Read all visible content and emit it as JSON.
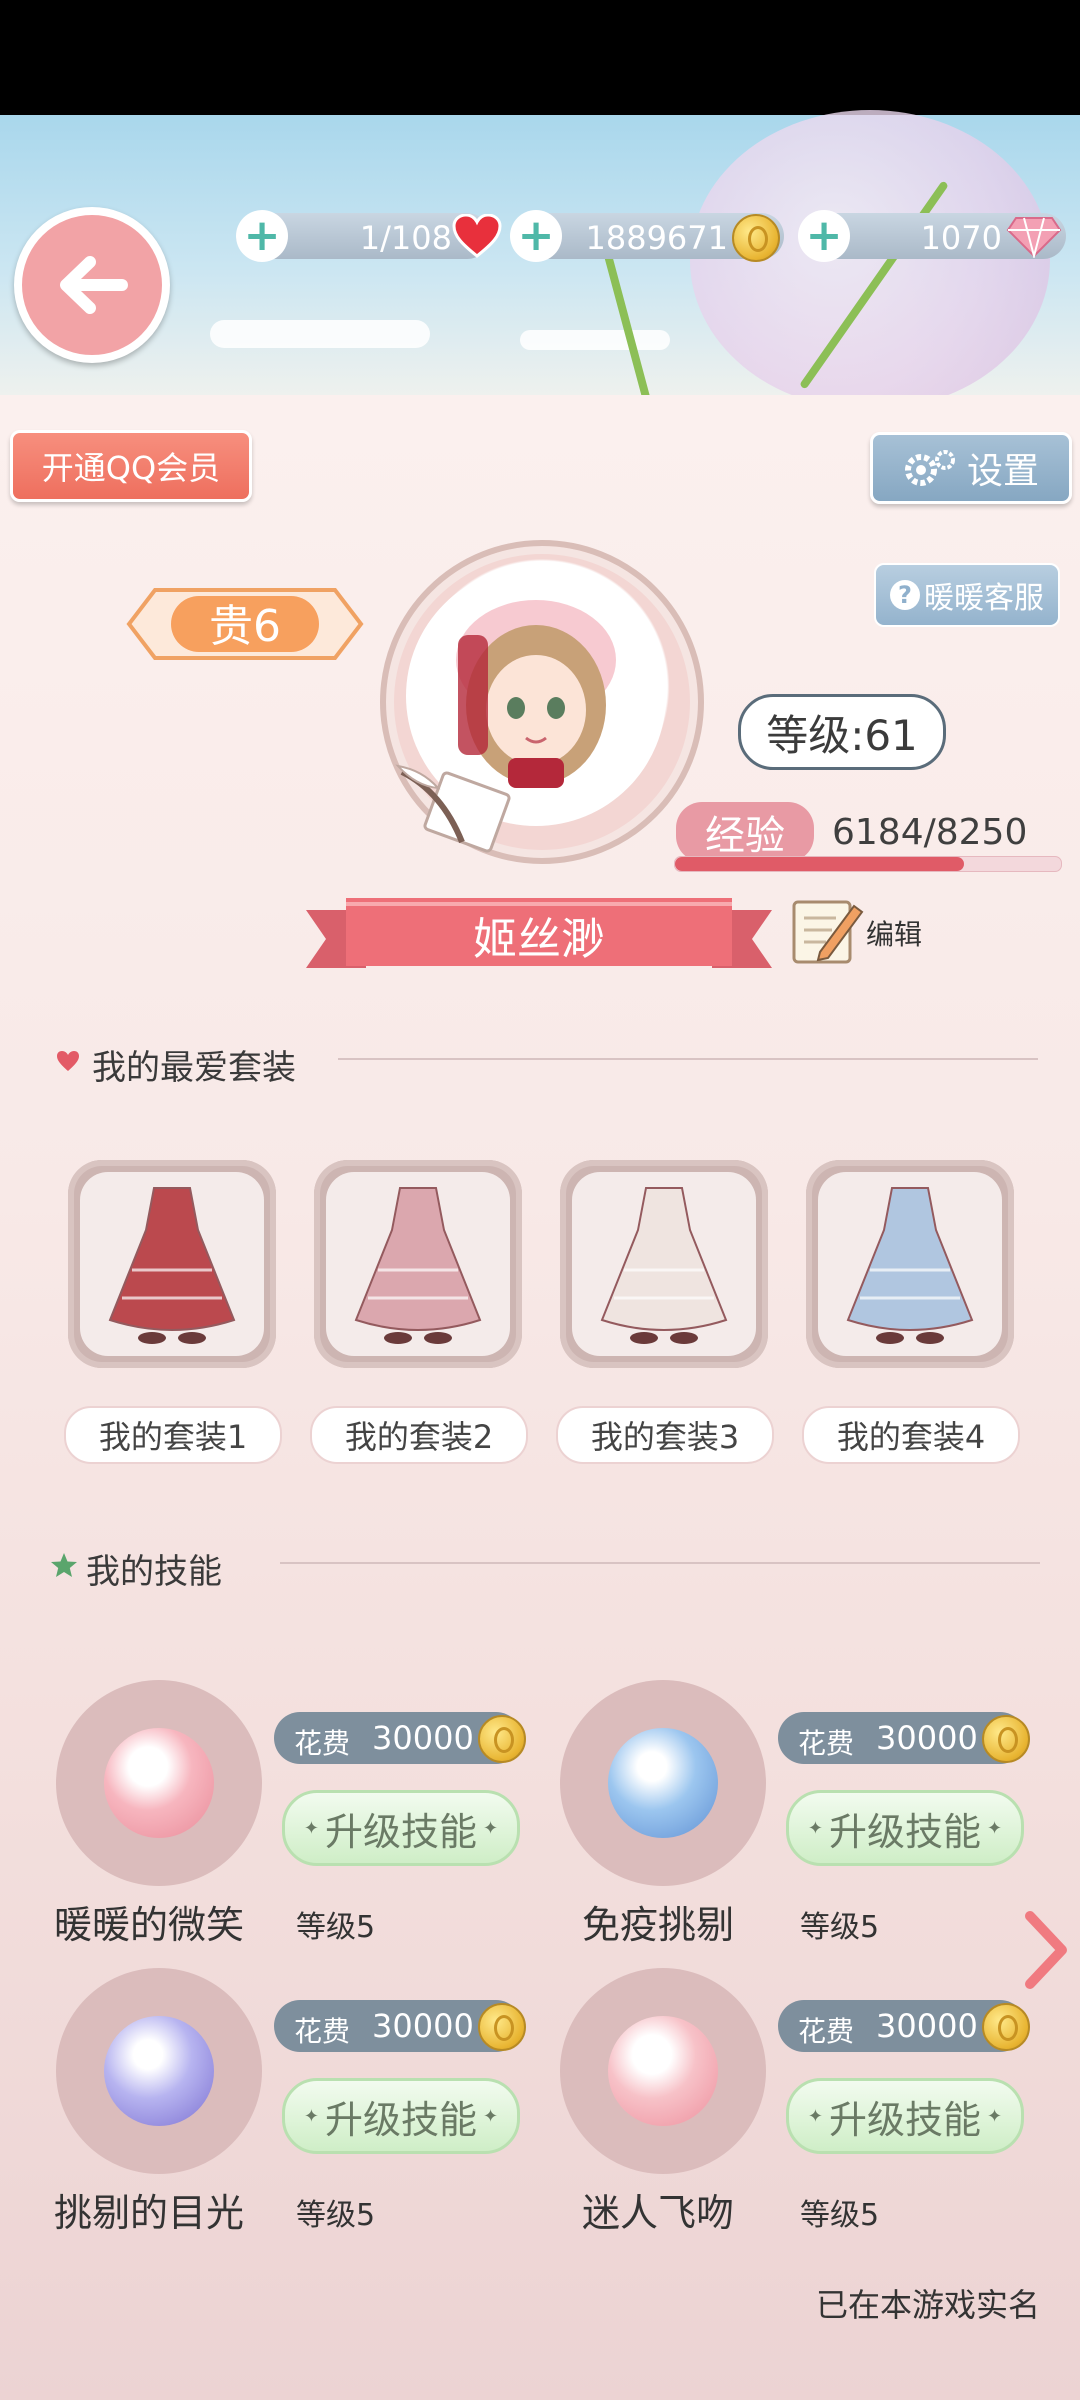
{
  "topbar": {
    "stamina": "1/108",
    "gold": "1889671",
    "diamonds": "1070"
  },
  "buttons": {
    "qq_member": "开通QQ会员",
    "settings": "设置",
    "customer_service": "暖暖客服",
    "edit": "编辑"
  },
  "profile": {
    "vip": "贵6",
    "level": "等级:61",
    "exp_label": "经验",
    "exp_value": "6184/8250",
    "exp_fraction": 0.7496,
    "name": "姬丝渺"
  },
  "outfits": {
    "title": "我的最爱套装",
    "items": [
      {
        "label": "我的套装1",
        "color": "#b5383e"
      },
      {
        "label": "我的套装2",
        "color": "#d9a0a8"
      },
      {
        "label": "我的套装3",
        "color": "#efe4e0"
      },
      {
        "label": "我的套装4",
        "color": "#a9c2e0"
      }
    ]
  },
  "skills": {
    "title": "我的技能",
    "items": [
      {
        "name": "暖暖的微笑",
        "level": "等级5",
        "cost_label": "花费",
        "cost": "30000",
        "upgrade": "升级技能",
        "icon": "sakura-icon"
      },
      {
        "name": "免疫挑剔",
        "level": "等级5",
        "cost_label": "花费",
        "cost": "30000",
        "upgrade": "升级技能",
        "icon": "winged-mask-icon"
      },
      {
        "name": "挑剔的目光",
        "level": "等级5",
        "cost_label": "花费",
        "cost": "30000",
        "upgrade": "升级技能",
        "icon": "mask-icon"
      },
      {
        "name": "迷人飞吻",
        "level": "等级5",
        "cost_label": "花费",
        "cost": "30000",
        "upgrade": "升级技能",
        "icon": "heart-icon"
      }
    ]
  },
  "footer": {
    "realname": "已在本游戏实名"
  }
}
